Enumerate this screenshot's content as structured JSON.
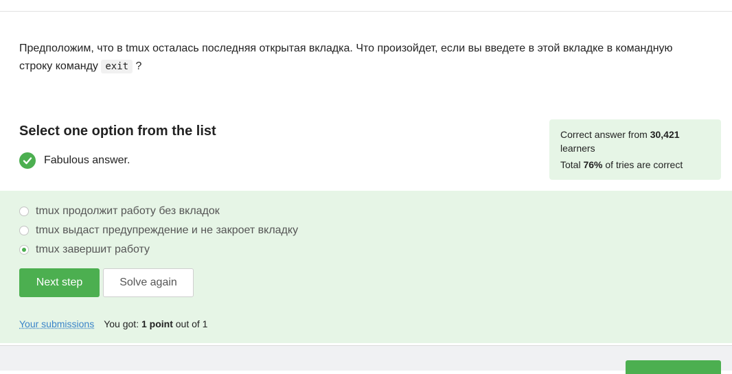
{
  "question": {
    "text_before": "Предположим, что в tmux осталась последняя открытая вкладка. Что произойдет, если вы введете в этой вкладке в командную строку команду ",
    "code": "exit",
    "text_after": " ?"
  },
  "quiz": {
    "title": "Select one option from the list",
    "feedback": "Fabulous answer."
  },
  "stats": {
    "prefix": "Correct answer from ",
    "learners": "30,421",
    "suffix": " learners",
    "total_prefix": "Total ",
    "percent": "76%",
    "total_suffix": " of tries are correct"
  },
  "options": [
    {
      "label": "tmux продолжит работу без вкладок",
      "selected": false
    },
    {
      "label": "tmux выдаст предупреждение и не закроет вкладку",
      "selected": false
    },
    {
      "label": "tmux завершит работу",
      "selected": true
    }
  ],
  "buttons": {
    "next": "Next step",
    "again": "Solve again"
  },
  "submission": {
    "link": "Your submissions",
    "got": "You got: ",
    "points": "1 point",
    "out_of": " out of 1"
  },
  "colors": {
    "accent": "#4caf50",
    "panel": "#e6f5e6",
    "link": "#3a84c9"
  }
}
